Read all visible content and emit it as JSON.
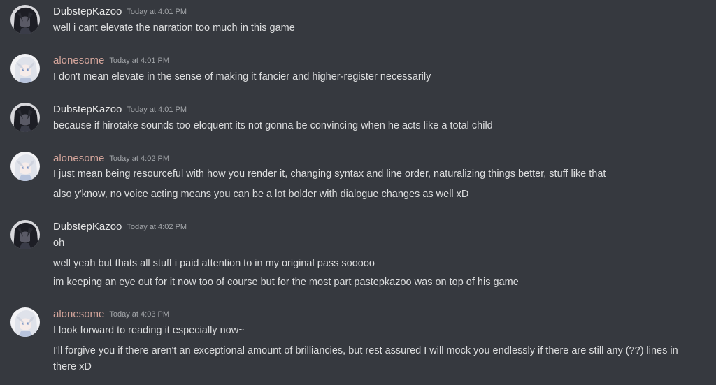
{
  "colors": {
    "background": "#36393f",
    "text": "#dcddde",
    "timestamp": "#a3a6aa",
    "user_dubstepkazoo": "#e6e6e6",
    "user_alonesome": "#d4a59b"
  },
  "messages": [
    {
      "username": "DubstepKazoo",
      "timestamp": "Today at 4:01 PM",
      "avatar": "dark-anime-avatar",
      "lines": [
        "well i cant elevate the narration too much in this game"
      ]
    },
    {
      "username": "alonesome",
      "timestamp": "Today at 4:01 PM",
      "avatar": "white-hair-anime-avatar",
      "lines": [
        "I don't mean elevate in the sense of making it fancier and higher-register necessarily"
      ]
    },
    {
      "username": "DubstepKazoo",
      "timestamp": "Today at 4:01 PM",
      "avatar": "dark-anime-avatar",
      "lines": [
        "because if hirotake sounds too eloquent its not gonna be convincing when he acts like a total child"
      ]
    },
    {
      "username": "alonesome",
      "timestamp": "Today at 4:02 PM",
      "avatar": "white-hair-anime-avatar",
      "lines": [
        "I just mean being resourceful with how you render it, changing syntax and line order, naturalizing things better, stuff like that",
        "also y'know, no voice acting means you can be a lot bolder with dialogue changes as well xD"
      ]
    },
    {
      "username": "DubstepKazoo",
      "timestamp": "Today at 4:02 PM",
      "avatar": "dark-anime-avatar",
      "lines": [
        "oh",
        "well yeah but thats all stuff i paid attention to in my original pass sooooo",
        "im keeping an eye out for it now too of course but for the most part pastepkazoo was on top of his game"
      ]
    },
    {
      "username": "alonesome",
      "timestamp": "Today at 4:03 PM",
      "avatar": "white-hair-anime-avatar",
      "lines": [
        "I look forward to reading it especially now~",
        "I'll forgive you if there aren't an exceptional amount of brilliancies, but rest assured I will mock you endlessly if there are still any (??) lines in there xD"
      ]
    }
  ]
}
